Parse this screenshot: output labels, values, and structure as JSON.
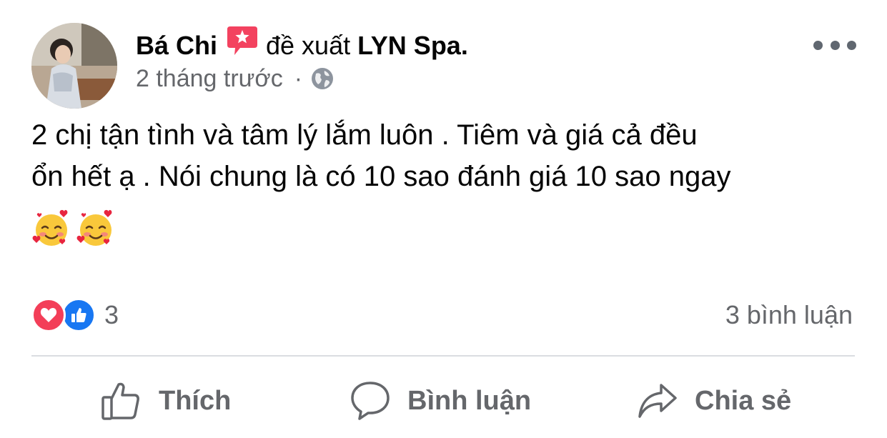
{
  "post": {
    "author": "Bá Chi",
    "verb": "đề xuất",
    "page": "LYN Spa.",
    "time": "2 tháng trước",
    "separator": "·",
    "privacy_icon": "globe-icon",
    "text_line1": "2 chị tận tình và tâm lý lắm luôn . Tiêm và giá cả đều",
    "text_line2": "ổn hết ạ . Nói chung là có 10 sao đánh giá 10 sao ngay",
    "emojis": [
      "smiling-face-with-hearts-emoji",
      "smiling-face-with-hearts-emoji"
    ]
  },
  "reactions": {
    "types": [
      "love",
      "like"
    ],
    "count": "3",
    "comments": "3 bình luận"
  },
  "actions": {
    "like": "Thích",
    "comment": "Bình luận",
    "share": "Chia sẻ"
  },
  "colors": {
    "love": "#f33e58",
    "like": "#1877f2",
    "recommend": "#f3425f",
    "secondary_text": "#65676b"
  }
}
